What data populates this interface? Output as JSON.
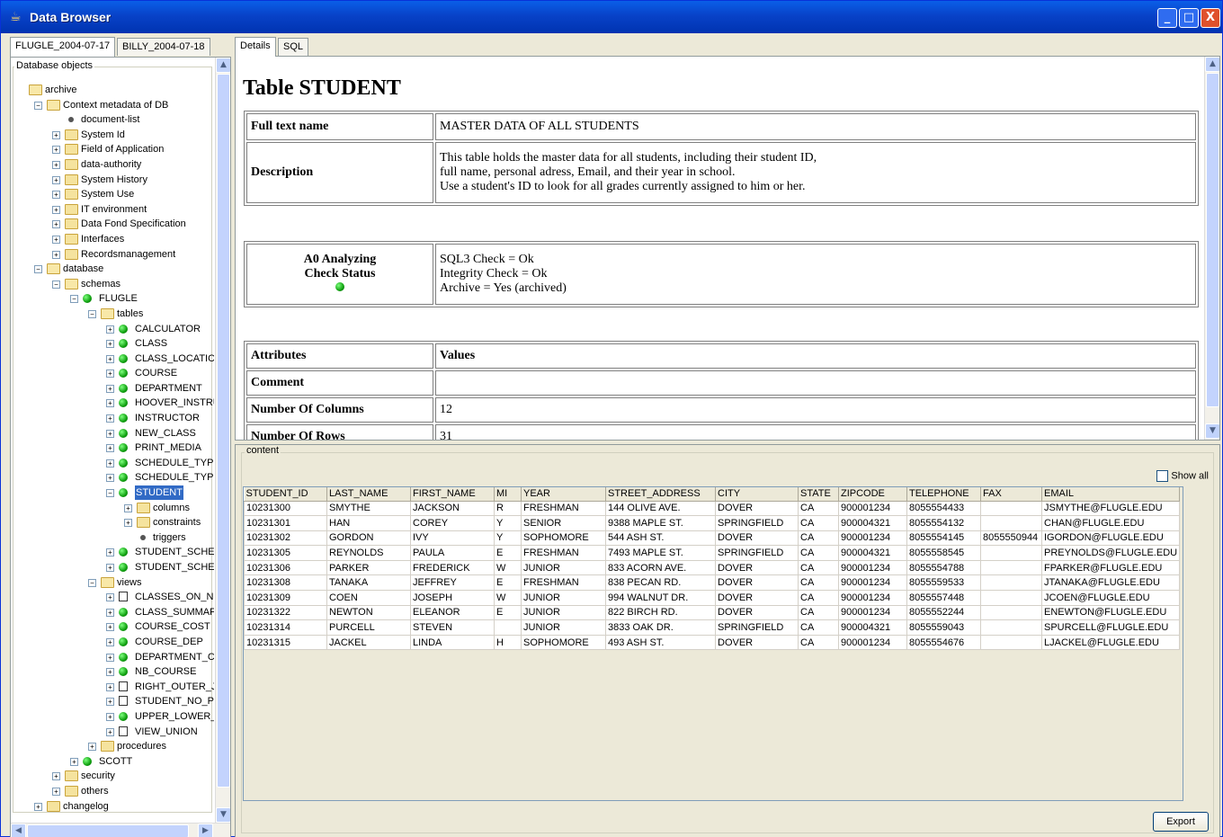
{
  "window": {
    "title": "Data Browser",
    "buttons": {
      "minimize": "_",
      "maximize": "□",
      "close": "X"
    }
  },
  "left_tabs": [
    "FLUGLE_2004-07-17",
    "BILLY_2004-07-18"
  ],
  "tree_legend": "Database objects",
  "tree": [
    {
      "label": "archive",
      "icon": "folder-open",
      "level": 0
    },
    {
      "label": "Context metadata of DB",
      "icon": "folder-open",
      "level": 1,
      "expander": "−"
    },
    {
      "label": "document-list",
      "icon": "bullet",
      "level": 2
    },
    {
      "label": "System Id",
      "icon": "folder",
      "level": 2,
      "expander": "+"
    },
    {
      "label": "Field of Application",
      "icon": "folder",
      "level": 2,
      "expander": "+"
    },
    {
      "label": "data-authority",
      "icon": "folder",
      "level": 2,
      "expander": "+"
    },
    {
      "label": "System History",
      "icon": "folder",
      "level": 2,
      "expander": "+"
    },
    {
      "label": "System Use",
      "icon": "folder",
      "level": 2,
      "expander": "+"
    },
    {
      "label": "IT environment",
      "icon": "folder",
      "level": 2,
      "expander": "+"
    },
    {
      "label": "Data Fond Specification",
      "icon": "folder",
      "level": 2,
      "expander": "+"
    },
    {
      "label": "Interfaces",
      "icon": "folder",
      "level": 2,
      "expander": "+"
    },
    {
      "label": "Recordsmanagement",
      "icon": "folder",
      "level": 2,
      "expander": "+"
    },
    {
      "label": "database",
      "icon": "folder-open",
      "level": 1,
      "expander": "−"
    },
    {
      "label": "schemas",
      "icon": "folder-open",
      "level": 2,
      "expander": "−"
    },
    {
      "label": "FLUGLE",
      "icon": "dot",
      "level": 3,
      "expander": "−"
    },
    {
      "label": "tables",
      "icon": "folder-open",
      "level": 4,
      "expander": "−"
    },
    {
      "label": "CALCULATOR",
      "icon": "dot",
      "level": 5,
      "expander": "+"
    },
    {
      "label": "CLASS",
      "icon": "dot",
      "level": 5,
      "expander": "+"
    },
    {
      "label": "CLASS_LOCATIC",
      "icon": "dot",
      "level": 5,
      "expander": "+"
    },
    {
      "label": "COURSE",
      "icon": "dot",
      "level": 5,
      "expander": "+"
    },
    {
      "label": "DEPARTMENT",
      "icon": "dot",
      "level": 5,
      "expander": "+"
    },
    {
      "label": "HOOVER_INSTRU",
      "icon": "dot",
      "level": 5,
      "expander": "+"
    },
    {
      "label": "INSTRUCTOR",
      "icon": "dot",
      "level": 5,
      "expander": "+"
    },
    {
      "label": "NEW_CLASS",
      "icon": "dot",
      "level": 5,
      "expander": "+"
    },
    {
      "label": "PRINT_MEDIA",
      "icon": "dot",
      "level": 5,
      "expander": "+"
    },
    {
      "label": "SCHEDULE_TYPE",
      "icon": "dot",
      "level": 5,
      "expander": "+"
    },
    {
      "label": "SCHEDULE_TYPE",
      "icon": "dot",
      "level": 5,
      "expander": "+"
    },
    {
      "label": "STUDENT",
      "icon": "dot",
      "level": 5,
      "expander": "−",
      "selected": true
    },
    {
      "label": "columns",
      "icon": "folder",
      "level": 6,
      "expander": "+"
    },
    {
      "label": "constraints",
      "icon": "folder",
      "level": 6,
      "expander": "+"
    },
    {
      "label": "triggers",
      "icon": "bullet",
      "level": 6
    },
    {
      "label": "STUDENT_SCHEI",
      "icon": "dot",
      "level": 5,
      "expander": "+"
    },
    {
      "label": "STUDENT_SCHEI",
      "icon": "dot",
      "level": 5,
      "expander": "+"
    },
    {
      "label": "views",
      "icon": "folder-open",
      "level": 4,
      "expander": "−"
    },
    {
      "label": "CLASSES_ON_N",
      "icon": "view",
      "level": 5,
      "expander": "+"
    },
    {
      "label": "CLASS_SUMMAF",
      "icon": "dot",
      "level": 5,
      "expander": "+"
    },
    {
      "label": "COURSE_COST",
      "icon": "dot",
      "level": 5,
      "expander": "+"
    },
    {
      "label": "COURSE_DEP",
      "icon": "dot",
      "level": 5,
      "expander": "+"
    },
    {
      "label": "DEPARTMENT_CI",
      "icon": "dot",
      "level": 5,
      "expander": "+"
    },
    {
      "label": "NB_COURSE",
      "icon": "dot",
      "level": 5,
      "expander": "+"
    },
    {
      "label": "RIGHT_OUTER_J",
      "icon": "view",
      "level": 5,
      "expander": "+"
    },
    {
      "label": "STUDENT_NO_PI",
      "icon": "view",
      "level": 5,
      "expander": "+"
    },
    {
      "label": "UPPER_LOWER_\\",
      "icon": "dot",
      "level": 5,
      "expander": "+"
    },
    {
      "label": "VIEW_UNION",
      "icon": "view",
      "level": 5,
      "expander": "+"
    },
    {
      "label": "procedures",
      "icon": "folder",
      "level": 4,
      "expander": "+"
    },
    {
      "label": "SCOTT",
      "icon": "dot",
      "level": 3,
      "expander": "+"
    },
    {
      "label": "security",
      "icon": "folder",
      "level": 2,
      "expander": "+"
    },
    {
      "label": "others",
      "icon": "folder",
      "level": 2,
      "expander": "+"
    },
    {
      "label": "changelog",
      "icon": "folder",
      "level": 1,
      "expander": "+"
    }
  ],
  "right_tabs": [
    "Details",
    "SQL"
  ],
  "details": {
    "title": "Table STUDENT",
    "full_text_label": "Full text name",
    "full_text_value": "MASTER DATA OF ALL STUDENTS",
    "description_label": "Description",
    "description_lines": [
      "This table holds the master data for all students, including their student ID,",
      "full name, personal adress, Email, and their year in school.",
      "Use a student's ID to look for all grades currently assigned to him or her."
    ],
    "status_label_1": "A0 Analyzing",
    "status_label_2": "Check Status",
    "status_lines": [
      "SQL3 Check = Ok",
      "Integrity Check = Ok",
      "Archive = Yes (archived)"
    ],
    "attr_header": "Attributes",
    "values_header": "Values",
    "comment_label": "Comment",
    "comment_value": "",
    "num_columns_label": "Number Of Columns",
    "num_columns_value": "12",
    "num_rows_label": "Number Of Rows",
    "num_rows_value": "31"
  },
  "content": {
    "legend": "content",
    "show_all_label": "Show all",
    "show_all_checked": false,
    "export_label": "Export",
    "columns": [
      "STUDENT_ID",
      "LAST_NAME",
      "FIRST_NAME",
      "MI",
      "YEAR",
      "STREET_ADDRESS",
      "CITY",
      "STATE",
      "ZIPCODE",
      "TELEPHONE",
      "FAX",
      "EMAIL"
    ],
    "rows": [
      [
        "10231300",
        "SMYTHE",
        "JACKSON",
        "R",
        "FRESHMAN",
        "144 OLIVE AVE.",
        "DOVER",
        "CA",
        "900001234",
        "8055554433",
        "",
        "JSMYTHE@FLUGLE.EDU"
      ],
      [
        "10231301",
        "HAN",
        "COREY",
        "Y",
        "SENIOR",
        "9388 MAPLE ST.",
        "SPRINGFIELD",
        "CA",
        "900004321",
        "8055554132",
        "",
        "CHAN@FLUGLE.EDU"
      ],
      [
        "10231302",
        "GORDON",
        "IVY",
        "Y",
        "SOPHOMORE",
        "544 ASH ST.",
        "DOVER",
        "CA",
        "900001234",
        "8055554145",
        "8055550944",
        "IGORDON@FLUGLE.EDU"
      ],
      [
        "10231305",
        "REYNOLDS",
        "PAULA",
        "E",
        "FRESHMAN",
        "7493 MAPLE ST.",
        "SPRINGFIELD",
        "CA",
        "900004321",
        "8055558545",
        "",
        "PREYNOLDS@FLUGLE.EDU"
      ],
      [
        "10231306",
        "PARKER",
        "FREDERICK",
        "W",
        "JUNIOR",
        "833 ACORN AVE.",
        "DOVER",
        "CA",
        "900001234",
        "8055554788",
        "",
        "FPARKER@FLUGLE.EDU"
      ],
      [
        "10231308",
        "TANAKA",
        "JEFFREY",
        "E",
        "FRESHMAN",
        "838 PECAN RD.",
        "DOVER",
        "CA",
        "900001234",
        "8055559533",
        "",
        "JTANAKA@FLUGLE.EDU"
      ],
      [
        "10231309",
        "COEN",
        "JOSEPH",
        "W",
        "JUNIOR",
        "994 WALNUT DR.",
        "DOVER",
        "CA",
        "900001234",
        "8055557448",
        "",
        "JCOEN@FLUGLE.EDU"
      ],
      [
        "10231322",
        "NEWTON",
        "ELEANOR",
        "E",
        "JUNIOR",
        "822 BIRCH RD.",
        "DOVER",
        "CA",
        "900001234",
        "8055552244",
        "",
        "ENEWTON@FLUGLE.EDU"
      ],
      [
        "10231314",
        "PURCELL",
        "STEVEN",
        "",
        "JUNIOR",
        "3833 OAK DR.",
        "SPRINGFIELD",
        "CA",
        "900004321",
        "8055559043",
        "",
        "SPURCELL@FLUGLE.EDU"
      ],
      [
        "10231315",
        "JACKEL",
        "LINDA",
        "H",
        "SOPHOMORE",
        "493 ASH ST.",
        "DOVER",
        "CA",
        "900001234",
        "8055554676",
        "",
        "LJACKEL@FLUGLE.EDU"
      ]
    ]
  }
}
